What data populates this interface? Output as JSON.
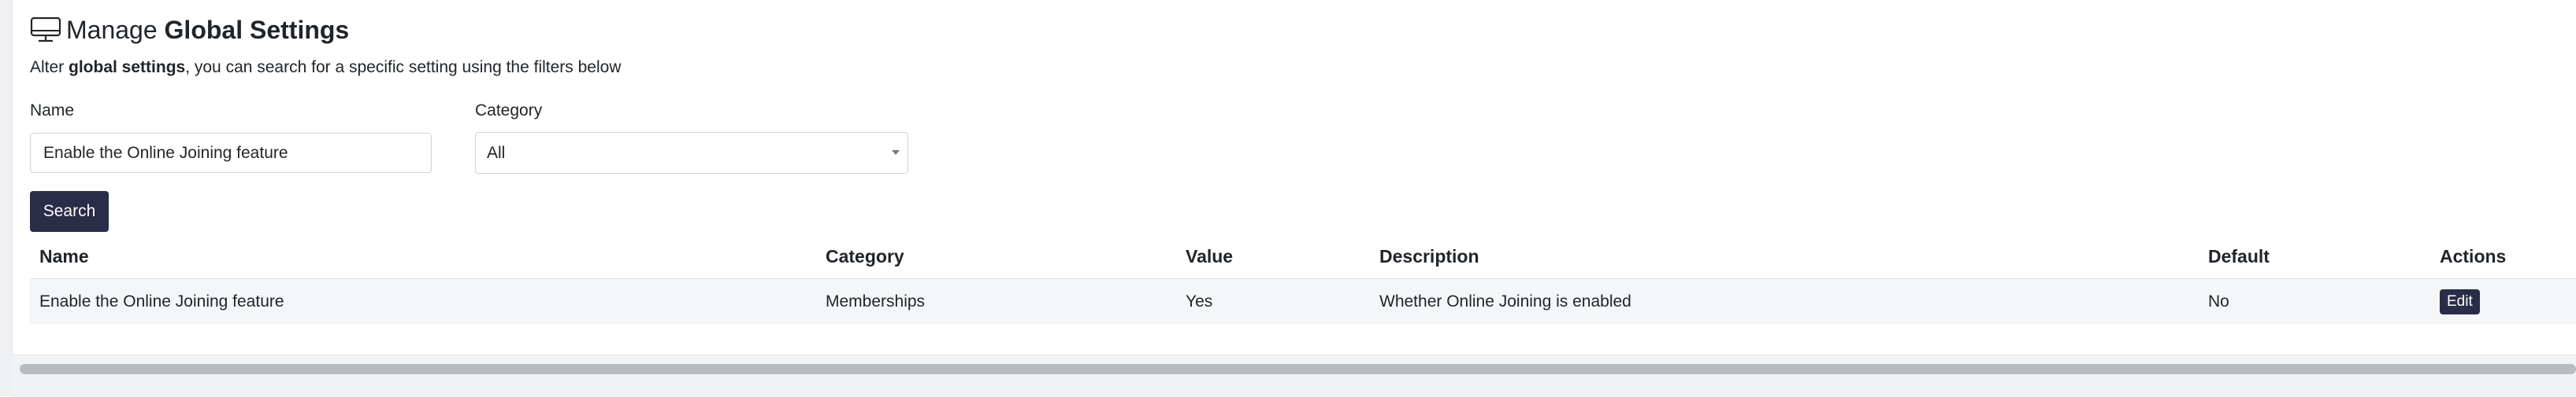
{
  "header": {
    "title_prefix": "Manage",
    "title_strong": "Global Settings",
    "icon": "monitor-icon"
  },
  "subtitle": {
    "prefix": "Alter ",
    "strong": "global settings",
    "suffix": ", you can search for a specific setting using the filters below"
  },
  "filters": {
    "name_label": "Name",
    "name_value": "Enable the Online Joining feature",
    "category_label": "Category",
    "category_value": "All",
    "search_label": "Search"
  },
  "table": {
    "headers": [
      "Name",
      "Category",
      "Value",
      "Description",
      "Default",
      "Actions"
    ],
    "rows": [
      {
        "name": "Enable the Online Joining feature",
        "category": "Memberships",
        "value": "Yes",
        "description": "Whether Online Joining is enabled",
        "default": "No",
        "action_label": "Edit"
      }
    ]
  },
  "colors": {
    "primary_button": "#2a2d47",
    "row_background": "#f5f6f8"
  }
}
